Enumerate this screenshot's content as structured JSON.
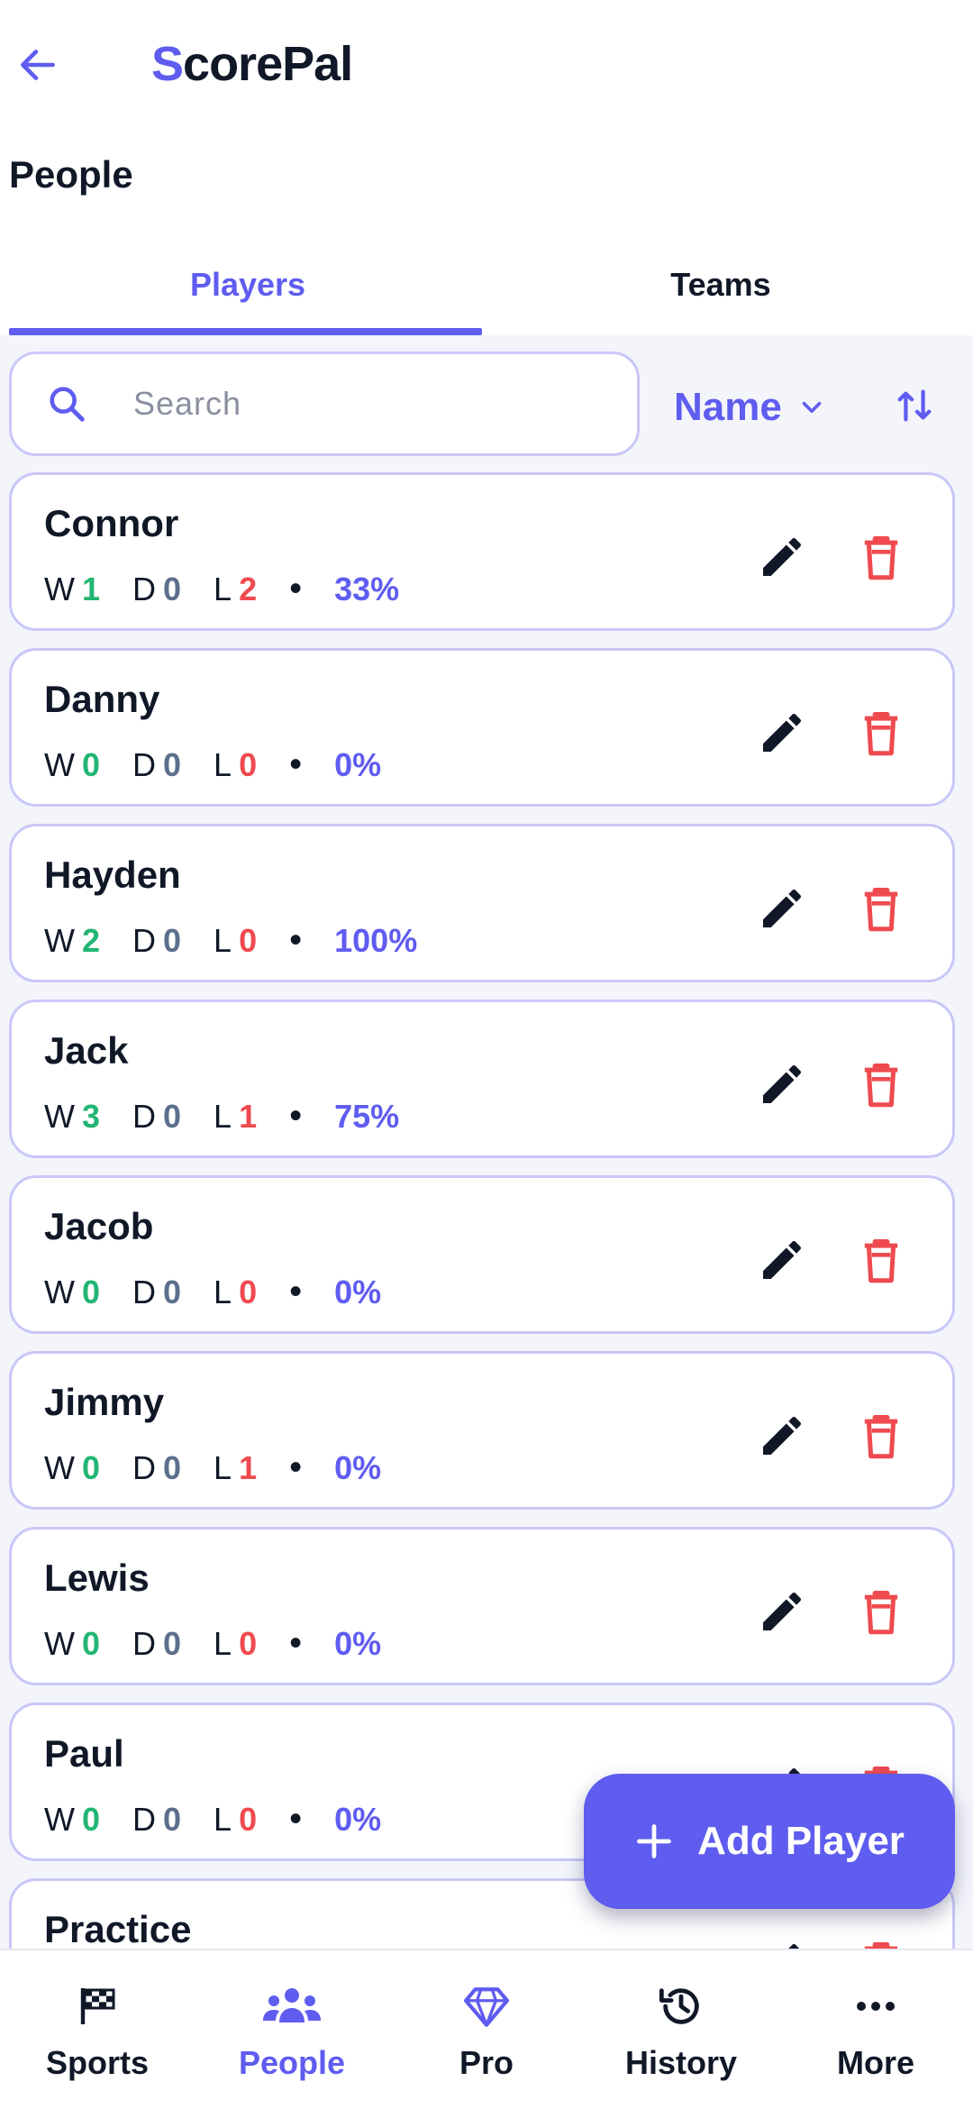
{
  "app": {
    "logo_first": "S",
    "logo_rest": "corePal"
  },
  "page": {
    "title": "People"
  },
  "tabs": [
    {
      "label": "Players",
      "active": true
    },
    {
      "label": "Teams",
      "active": false
    }
  ],
  "search": {
    "placeholder": "Search",
    "value": ""
  },
  "sort": {
    "field": "Name"
  },
  "stat_labels": {
    "w": "W",
    "d": "D",
    "l": "L",
    "dot": "•"
  },
  "players": [
    {
      "name": "Connor",
      "w": "1",
      "d": "0",
      "l": "2",
      "pct": "33%"
    },
    {
      "name": "Danny",
      "w": "0",
      "d": "0",
      "l": "0",
      "pct": "0%"
    },
    {
      "name": "Hayden",
      "w": "2",
      "d": "0",
      "l": "0",
      "pct": "100%"
    },
    {
      "name": "Jack",
      "w": "3",
      "d": "0",
      "l": "1",
      "pct": "75%"
    },
    {
      "name": "Jacob",
      "w": "0",
      "d": "0",
      "l": "0",
      "pct": "0%"
    },
    {
      "name": "Jimmy",
      "w": "0",
      "d": "0",
      "l": "1",
      "pct": "0%"
    },
    {
      "name": "Lewis",
      "w": "0",
      "d": "0",
      "l": "0",
      "pct": "0%"
    },
    {
      "name": "Paul",
      "w": "0",
      "d": "0",
      "l": "0",
      "pct": "0%"
    },
    {
      "name": "Practice"
    }
  ],
  "fab": {
    "label": "Add Player"
  },
  "nav": [
    {
      "label": "Sports",
      "icon": "checkered-flag-icon",
      "active": false
    },
    {
      "label": "People",
      "icon": "people-icon",
      "active": true
    },
    {
      "label": "Pro",
      "icon": "diamond-icon",
      "active": false
    },
    {
      "label": "History",
      "icon": "history-icon",
      "active": false
    },
    {
      "label": "More",
      "icon": "more-dots-icon",
      "active": false
    }
  ],
  "colors": {
    "accent": "#5f5cf0",
    "win": "#22b573",
    "draw": "#5c6e8a",
    "loss": "#ef4a4f",
    "card_border": "#c9c7f8",
    "list_bg": "#f4f5fb"
  }
}
